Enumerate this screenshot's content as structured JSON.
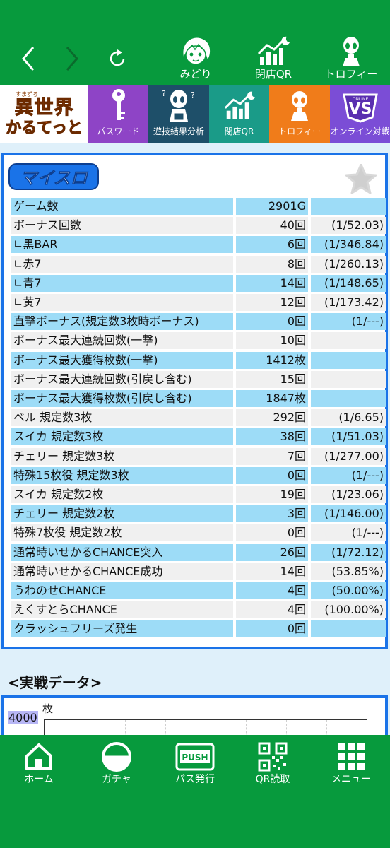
{
  "topbar": {
    "items": [
      {
        "label": "みどり",
        "icon": "character-face-icon"
      },
      {
        "label": "閉店QR",
        "icon": "chart-moon-icon"
      },
      {
        "label": "トロフィー",
        "icon": "alien-trophy-icon"
      }
    ]
  },
  "banner": {
    "logo": {
      "small": "すまずろ",
      "line1": "異世界",
      "line2": "かるてっと"
    },
    "tiles": [
      {
        "label": "パスワード",
        "color": "#8e44c6",
        "icon": "key-icon"
      },
      {
        "label": "遊技結果分析",
        "color": "#1e4f69",
        "icon": "alien-analysis-icon"
      },
      {
        "label": "閉店QR",
        "color": "#1a9b88",
        "icon": "chart-moon-icon"
      },
      {
        "label": "トロフィー",
        "color": "#f07c1a",
        "icon": "alien-trophy-icon"
      },
      {
        "label": "オンライン対戦",
        "color": "#7b4dd6",
        "icon": "online-vs-icon"
      }
    ]
  },
  "stats": {
    "logo": "マイスロ",
    "rows": [
      {
        "label": "ゲーム数",
        "value": "2901G",
        "rate": ""
      },
      {
        "label": "ボーナス回数",
        "value": "40回",
        "rate": "(1/52.03)"
      },
      {
        "label": "∟黒BAR",
        "value": "6回",
        "rate": "(1/346.84)"
      },
      {
        "label": "∟赤7",
        "value": "8回",
        "rate": "(1/260.13)"
      },
      {
        "label": "∟青7",
        "value": "14回",
        "rate": "(1/148.65)"
      },
      {
        "label": "∟黄7",
        "value": "12回",
        "rate": "(1/173.42)"
      },
      {
        "label": "直撃ボーナス(規定数3枚時ボーナス)",
        "value": "0回",
        "rate": "(1/---)"
      },
      {
        "label": "ボーナス最大連続回数(一撃)",
        "value": "10回",
        "rate": ""
      },
      {
        "label": "ボーナス最大獲得枚数(一撃)",
        "value": "1412枚",
        "rate": ""
      },
      {
        "label": "ボーナス最大連続回数(引戻し含む)",
        "value": "15回",
        "rate": ""
      },
      {
        "label": "ボーナス最大獲得枚数(引戻し含む)",
        "value": "1847枚",
        "rate": ""
      },
      {
        "label": "ベル 規定数3枚",
        "value": "292回",
        "rate": "(1/6.65)"
      },
      {
        "label": "スイカ 規定数3枚",
        "value": "38回",
        "rate": "(1/51.03)"
      },
      {
        "label": "チェリー 規定数3枚",
        "value": "7回",
        "rate": "(1/277.00)"
      },
      {
        "label": "特殊15枚役 規定数3枚",
        "value": "0回",
        "rate": "(1/---)"
      },
      {
        "label": "スイカ 規定数2枚",
        "value": "19回",
        "rate": "(1/23.06)"
      },
      {
        "label": "チェリー 規定数2枚",
        "value": "3回",
        "rate": "(1/146.00)"
      },
      {
        "label": "特殊7枚役 規定数2枚",
        "value": "0回",
        "rate": "(1/---)"
      },
      {
        "label": "通常時いせかるCHANCE突入",
        "value": "26回",
        "rate": "(1/72.12)"
      },
      {
        "label": "通常時いせかるCHANCE成功",
        "value": "14回",
        "rate": "(53.85%)"
      },
      {
        "label": "うわのせCHANCE",
        "value": "4回",
        "rate": "(50.00%)"
      },
      {
        "label": "えくすとらCHANCE",
        "value": "4回",
        "rate": "(100.00%)"
      },
      {
        "label": "クラッシュフリーズ発生",
        "value": "0回",
        "rate": ""
      }
    ]
  },
  "battle": {
    "title": "<実戦データ>",
    "unit": "枚",
    "ymax": "4000"
  },
  "bottomnav": {
    "items": [
      {
        "label": "ホーム",
        "icon": "home-icon"
      },
      {
        "label": "ガチャ",
        "icon": "gacha-ball-icon"
      },
      {
        "label": "パス発行",
        "icon": "push-pass-icon"
      },
      {
        "label": "QR読取",
        "icon": "qr-code-icon"
      },
      {
        "label": "メニュー",
        "icon": "grid-menu-icon"
      }
    ]
  },
  "colors": {
    "brand_green": "#079a3d",
    "accent_blue": "#1a73e8",
    "row_blue": "#9ddcf7",
    "row_gray": "#f0f0f0",
    "band": "#dff0fa"
  }
}
